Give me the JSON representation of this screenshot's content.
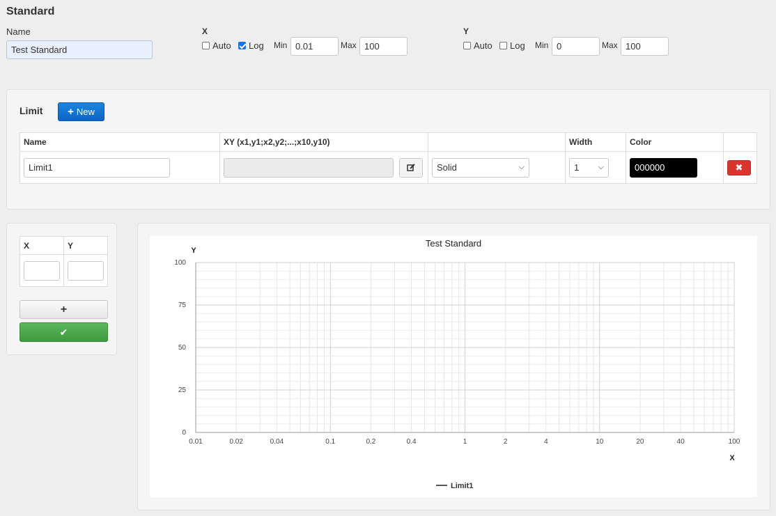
{
  "standard": {
    "title": "Standard",
    "name_label": "Name",
    "name_value": "Test Standard"
  },
  "x_axis": {
    "label": "X",
    "auto_label": "Auto",
    "auto_checked": false,
    "log_label": "Log",
    "log_checked": true,
    "min_label": "Min",
    "min_value": "0.01",
    "max_label": "Max",
    "max_value": "100"
  },
  "y_axis": {
    "label": "Y",
    "auto_label": "Auto",
    "auto_checked": false,
    "log_label": "Log",
    "log_checked": false,
    "min_label": "Min",
    "min_value": "0",
    "max_label": "Max",
    "max_value": "100"
  },
  "limit": {
    "title": "Limit",
    "new_button": "New",
    "columns": [
      "Name",
      "XY (x1,y1;x2,y2;...;x10,y10)",
      "",
      "Width",
      "Color",
      ""
    ],
    "rows": [
      {
        "name": "Limit1",
        "xy": "",
        "style": "Solid",
        "width": "1",
        "color": "000000"
      }
    ]
  },
  "points": {
    "columns": [
      "X",
      "Y"
    ],
    "add_icon": "plus-icon",
    "confirm_icon": "check-icon"
  },
  "colors": {
    "primary_button": "#0d63c7",
    "success_button": "#4cae4c",
    "danger_button": "#d9352f",
    "grid_line": "#e3e3e3"
  },
  "chart_data": {
    "type": "line",
    "title": "Test Standard",
    "xlabel": "X",
    "ylabel": "Y",
    "x_scale": "log",
    "xlim": [
      0.01,
      100
    ],
    "ylim": [
      0,
      100
    ],
    "x_ticks": [
      "0.01",
      "0.02",
      "0.04",
      "0.1",
      "0.2",
      "0.4",
      "1",
      "2",
      "4",
      "10",
      "20",
      "40",
      "100"
    ],
    "y_ticks": [
      "0",
      "25",
      "50",
      "75",
      "100"
    ],
    "grid": true,
    "legend_position": "bottom",
    "series": [
      {
        "name": "Limit1",
        "color": "#555555",
        "points": []
      }
    ]
  }
}
